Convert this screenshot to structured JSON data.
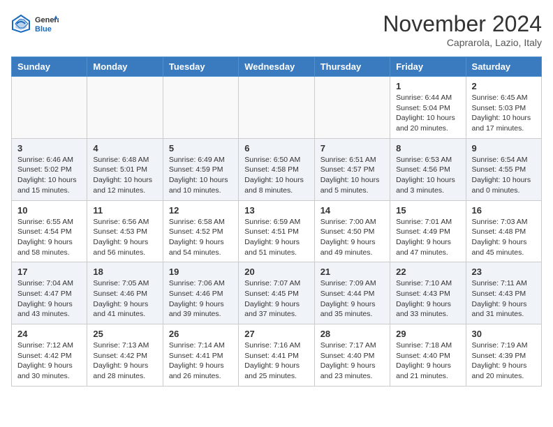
{
  "header": {
    "logo_line1": "General",
    "logo_line2": "Blue",
    "month": "November 2024",
    "location": "Caprarola, Lazio, Italy"
  },
  "days_of_week": [
    "Sunday",
    "Monday",
    "Tuesday",
    "Wednesday",
    "Thursday",
    "Friday",
    "Saturday"
  ],
  "weeks": [
    [
      {
        "day": "",
        "info": ""
      },
      {
        "day": "",
        "info": ""
      },
      {
        "day": "",
        "info": ""
      },
      {
        "day": "",
        "info": ""
      },
      {
        "day": "",
        "info": ""
      },
      {
        "day": "1",
        "info": "Sunrise: 6:44 AM\nSunset: 5:04 PM\nDaylight: 10 hours\nand 20 minutes."
      },
      {
        "day": "2",
        "info": "Sunrise: 6:45 AM\nSunset: 5:03 PM\nDaylight: 10 hours\nand 17 minutes."
      }
    ],
    [
      {
        "day": "3",
        "info": "Sunrise: 6:46 AM\nSunset: 5:02 PM\nDaylight: 10 hours\nand 15 minutes."
      },
      {
        "day": "4",
        "info": "Sunrise: 6:48 AM\nSunset: 5:01 PM\nDaylight: 10 hours\nand 12 minutes."
      },
      {
        "day": "5",
        "info": "Sunrise: 6:49 AM\nSunset: 4:59 PM\nDaylight: 10 hours\nand 10 minutes."
      },
      {
        "day": "6",
        "info": "Sunrise: 6:50 AM\nSunset: 4:58 PM\nDaylight: 10 hours\nand 8 minutes."
      },
      {
        "day": "7",
        "info": "Sunrise: 6:51 AM\nSunset: 4:57 PM\nDaylight: 10 hours\nand 5 minutes."
      },
      {
        "day": "8",
        "info": "Sunrise: 6:53 AM\nSunset: 4:56 PM\nDaylight: 10 hours\nand 3 minutes."
      },
      {
        "day": "9",
        "info": "Sunrise: 6:54 AM\nSunset: 4:55 PM\nDaylight: 10 hours\nand 0 minutes."
      }
    ],
    [
      {
        "day": "10",
        "info": "Sunrise: 6:55 AM\nSunset: 4:54 PM\nDaylight: 9 hours\nand 58 minutes."
      },
      {
        "day": "11",
        "info": "Sunrise: 6:56 AM\nSunset: 4:53 PM\nDaylight: 9 hours\nand 56 minutes."
      },
      {
        "day": "12",
        "info": "Sunrise: 6:58 AM\nSunset: 4:52 PM\nDaylight: 9 hours\nand 54 minutes."
      },
      {
        "day": "13",
        "info": "Sunrise: 6:59 AM\nSunset: 4:51 PM\nDaylight: 9 hours\nand 51 minutes."
      },
      {
        "day": "14",
        "info": "Sunrise: 7:00 AM\nSunset: 4:50 PM\nDaylight: 9 hours\nand 49 minutes."
      },
      {
        "day": "15",
        "info": "Sunrise: 7:01 AM\nSunset: 4:49 PM\nDaylight: 9 hours\nand 47 minutes."
      },
      {
        "day": "16",
        "info": "Sunrise: 7:03 AM\nSunset: 4:48 PM\nDaylight: 9 hours\nand 45 minutes."
      }
    ],
    [
      {
        "day": "17",
        "info": "Sunrise: 7:04 AM\nSunset: 4:47 PM\nDaylight: 9 hours\nand 43 minutes."
      },
      {
        "day": "18",
        "info": "Sunrise: 7:05 AM\nSunset: 4:46 PM\nDaylight: 9 hours\nand 41 minutes."
      },
      {
        "day": "19",
        "info": "Sunrise: 7:06 AM\nSunset: 4:46 PM\nDaylight: 9 hours\nand 39 minutes."
      },
      {
        "day": "20",
        "info": "Sunrise: 7:07 AM\nSunset: 4:45 PM\nDaylight: 9 hours\nand 37 minutes."
      },
      {
        "day": "21",
        "info": "Sunrise: 7:09 AM\nSunset: 4:44 PM\nDaylight: 9 hours\nand 35 minutes."
      },
      {
        "day": "22",
        "info": "Sunrise: 7:10 AM\nSunset: 4:43 PM\nDaylight: 9 hours\nand 33 minutes."
      },
      {
        "day": "23",
        "info": "Sunrise: 7:11 AM\nSunset: 4:43 PM\nDaylight: 9 hours\nand 31 minutes."
      }
    ],
    [
      {
        "day": "24",
        "info": "Sunrise: 7:12 AM\nSunset: 4:42 PM\nDaylight: 9 hours\nand 30 minutes."
      },
      {
        "day": "25",
        "info": "Sunrise: 7:13 AM\nSunset: 4:42 PM\nDaylight: 9 hours\nand 28 minutes."
      },
      {
        "day": "26",
        "info": "Sunrise: 7:14 AM\nSunset: 4:41 PM\nDaylight: 9 hours\nand 26 minutes."
      },
      {
        "day": "27",
        "info": "Sunrise: 7:16 AM\nSunset: 4:41 PM\nDaylight: 9 hours\nand 25 minutes."
      },
      {
        "day": "28",
        "info": "Sunrise: 7:17 AM\nSunset: 4:40 PM\nDaylight: 9 hours\nand 23 minutes."
      },
      {
        "day": "29",
        "info": "Sunrise: 7:18 AM\nSunset: 4:40 PM\nDaylight: 9 hours\nand 21 minutes."
      },
      {
        "day": "30",
        "info": "Sunrise: 7:19 AM\nSunset: 4:39 PM\nDaylight: 9 hours\nand 20 minutes."
      }
    ]
  ]
}
